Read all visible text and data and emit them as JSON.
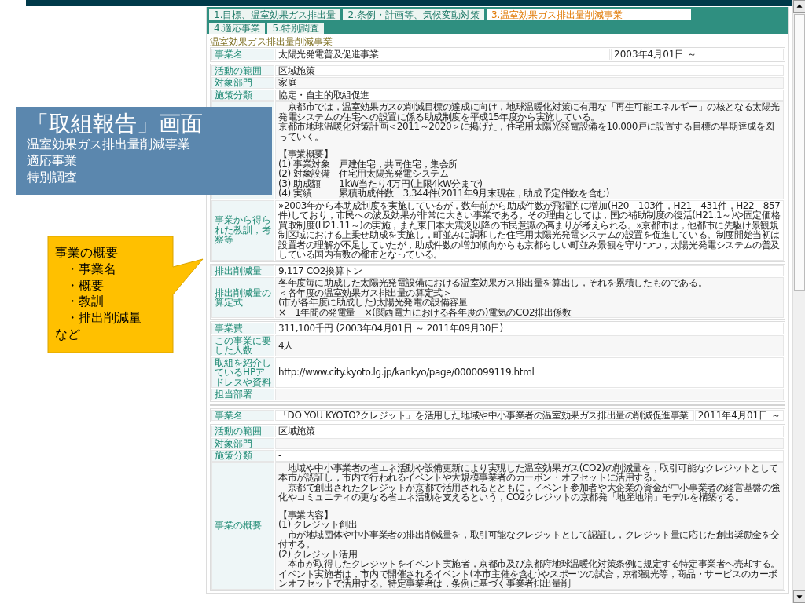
{
  "tab_rows": [
    {
      "tabs": [
        {
          "label": "1.目標、温室効果ガス排出量",
          "selected": false
        },
        {
          "label": "2.条例・計画等、気候変動対策",
          "selected": false
        },
        {
          "label": "3.温室効果ガス排出量削減事業",
          "selected": true
        }
      ]
    },
    {
      "tabs": [
        {
          "label": "4.適応事業",
          "selected": false
        },
        {
          "label": "5.特別調査",
          "selected": false
        }
      ]
    }
  ],
  "section_title": "温室効果ガス排出量削減事業",
  "projects": [
    {
      "groups": [
        {
          "rows": [
            {
              "label": "事業名",
              "value": "太陽光発電普及促進事業",
              "date": "2003年4月01日 ～"
            }
          ]
        },
        {
          "rows": [
            {
              "label": "活動の範囲",
              "value": "区域施策"
            },
            {
              "label": "対象部門",
              "value": "家庭"
            },
            {
              "label": "施策分類",
              "value": "協定・自主的取組促進"
            },
            {
              "paragraphs": [
                [
                  "　京都市では，温室効果ガスの削減目標の達成に向け，地球温暖化対策に有用な「再生可能エネルギー」の核となる太陽光発電システムの住宅への設置に係る助成制度を平成15年度から実施している。",
                  "京都市地球温暖化対策計画＜2011～2020＞に掲げた，住宅用太陽光発電設備を10,000戸に設置する目標の早期達成を図っていく。"
                ],
                [
                  "【事業概要】",
                  "(1) 事業対象　戸建住宅，共同住宅，集会所",
                  "(2) 対象設備　住宅用太陽光発電システム",
                  "(3) 助成額　　1kW当たり4万円(上限4kW分まで)",
                  "(4) 実績　　　累積助成件数　3,344件(2011年9月末現在，助成予定件数を含む)"
                ]
              ]
            },
            {
              "label": "事業から得られた教訓，考察等",
              "value": "»2003年から本助成制度を実施しているが，数年前から助成件数が飛躍的に増加(H20　103件，H21　431件，H22　857件)しており，市民への波及効果が非常に大きい事業である。その理由としては，国の補助制度の復活(H21.1～)や固定価格買取制度(H21.11～)の実施，また東日本大震災以降の市民意識の高まりが考えられる。»京都市は，他都市に先駆け景観規制区域における上乗せ助成を実施し，町並みに調和した住宅用太陽光発電システムの設置を促進している。制度開始当初は設置者の理解が不足していたが，助成件数の増加傾向からも京都らしい町並み景観を守りつつ，太陽光発電システムの普及している国内有数の都市となっている。"
            }
          ]
        },
        {
          "rows": [
            {
              "label": "排出削減量",
              "value": "9,117 CO2換算トン"
            },
            {
              "label": "排出削減量の算定式",
              "paragraphs": [
                [
                  "各年度毎に助成した太陽光発電設備における温室効果ガス排出量を算出し，それを累積したものである。",
                  "＜各年度の温室効果ガス排出量の算定式＞",
                  "(市が各年度に助成した)太陽光発電の設備容量",
                  "×　1年間の発電量　×(関西電力における各年度の)電気のCO2排出係数"
                ]
              ]
            }
          ]
        },
        {
          "rows": [
            {
              "label": "事業費",
              "value": "311,100千円 (2003年04月01日 ～ 2011年09月30日)"
            },
            {
              "label": "この事業に要した人数",
              "value": "4人"
            },
            {
              "label": "取組を紹介しているHPアドレスや資料",
              "value": "http://www.city.kyoto.lg.jp/kankyo/page/0000099119.html"
            },
            {
              "label": "担当部署"
            }
          ]
        }
      ]
    },
    {
      "groups": [
        {
          "rows": [
            {
              "label": "事業名",
              "value": "「DO YOU KYOTO?クレジット」を活用した地域や中小事業者の温室効果ガス排出量の削減促進事業",
              "date": "2011年4月01日 ～"
            }
          ]
        },
        {
          "rows": [
            {
              "label": "活動の範囲",
              "value": "区域施策"
            },
            {
              "label": "対象部門",
              "value": "-"
            },
            {
              "label": "施策分類",
              "value": "-"
            },
            {
              "label": "事業の概要",
              "paragraphs": [
                [
                  "　地域や中小事業者の省エネ活動や設備更新により実現した温室効果ガス(CO2)の削減量を，取引可能なクレジットとして本市が認証し，市内で行われるイベントや大規模事業者のカーボン・オフセットに活用する。",
                  "　京都で創出されたクレジットが京都で活用されるとともに，イベント参加者や大企業の資金が中小事業者の経営基盤の強化やコミュニティの更なる省エネ活動を支えるという，CO2クレジットの京都発「地産地消」モデルを構築する。"
                ],
                [
                  "【事業内容】",
                  "(1) クレジット創出",
                  "　市が地域団体や中小事業者の排出削減量を，取引可能なクレジットとして認証し，クレジット量に応じた創出奨励金を交付する。",
                  "(2) クレジット活用",
                  "　本市が取得したクレジットをイベント実施者，京都市及び京都府地球温暖化対策条例に規定する特定事業者へ売却する。イベント実施者は，市内で開催されるイベント(本市主催を含む)やスポーツの試合，京都観光等，商品・サービスのカーボンオフセットで活用する。特定事業者は，条例に基づく事業者排出量削"
                ]
              ]
            }
          ]
        }
      ]
    }
  ],
  "overlay": {
    "title": "「取組報告」画面",
    "lines": [
      "温室効果ガス排出量削減事業",
      "適応事業",
      "特別調査"
    ]
  },
  "callout": {
    "title": "事業の概要",
    "items": [
      "・事業名",
      "・概要",
      "・教訓",
      "・排出削減量"
    ],
    "footer": "など"
  }
}
